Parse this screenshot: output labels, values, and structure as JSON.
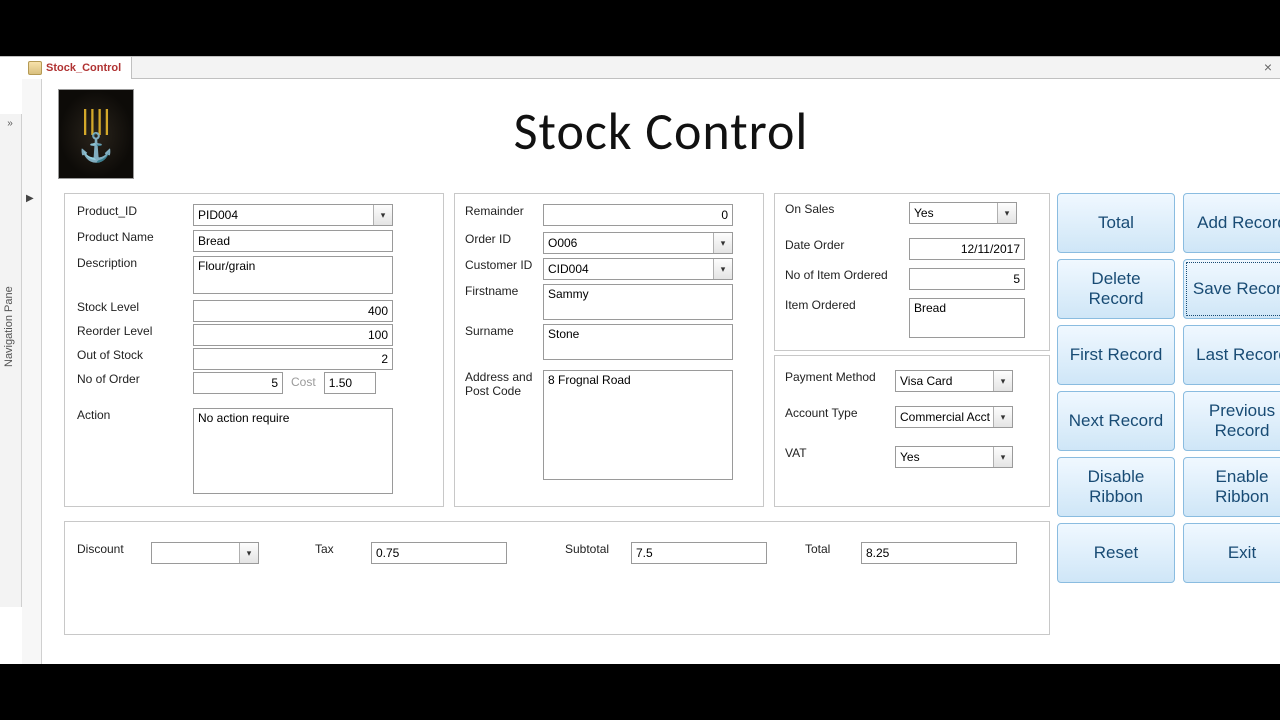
{
  "tab": {
    "title": "Stock_Control"
  },
  "nav_pane_label": "Navigation Pane",
  "form_title": "Stock  Control",
  "labels": {
    "product_id": "Product_ID",
    "product_name": "Product Name",
    "description": "Description",
    "stock_level": "Stock Level",
    "reorder_level": "Reorder Level",
    "out_of_stock": "Out of Stock",
    "no_of_order": "No of Order",
    "cost": "Cost",
    "action": "Action",
    "remainder": "Remainder",
    "order_id": "Order ID",
    "customer_id": "Customer ID",
    "firstname": "Firstname",
    "surname": "Surname",
    "address": "Address and Post Code",
    "on_sales": "On Sales",
    "date_order": "Date Order",
    "no_item_ordered": "No of Item Ordered",
    "item_ordered": "Item Ordered",
    "payment_method": "Payment Method",
    "account_type": "Account Type",
    "vat": "VAT",
    "discount": "Discount",
    "tax": "Tax",
    "subtotal": "Subtotal",
    "total": "Total"
  },
  "product": {
    "id": "PID004",
    "name": "Bread",
    "description": "Flour/grain",
    "stock_level": "400",
    "reorder_level": "100",
    "out_of_stock": "2",
    "no_of_order": "5",
    "cost": "1.50",
    "action": "No action require"
  },
  "order": {
    "remainder": "0",
    "id": "O006",
    "customer_id": "CID004",
    "firstname": "Sammy",
    "surname": "Stone",
    "address": "8 Frognal Road"
  },
  "sales": {
    "on_sales": "Yes",
    "date_order": "12/11/2017",
    "no_item_ordered": "5",
    "item_ordered": "Bread"
  },
  "payment": {
    "method": "Visa Card",
    "account_type": "Commercial Acct",
    "vat": "Yes"
  },
  "totals": {
    "discount": "",
    "tax": "0.75",
    "subtotal": "7.5",
    "total": "8.25"
  },
  "buttons": {
    "total": "Total",
    "add": "Add Record",
    "delete": "Delete Record",
    "save": "Save Record",
    "first": "First Record",
    "last": "Last Record",
    "next": "Next Record",
    "previous": "Previous Record",
    "disable_ribbon": "Disable Ribbon",
    "enable_ribbon": "Enable Ribbon",
    "reset": "Reset",
    "exit": "Exit"
  }
}
